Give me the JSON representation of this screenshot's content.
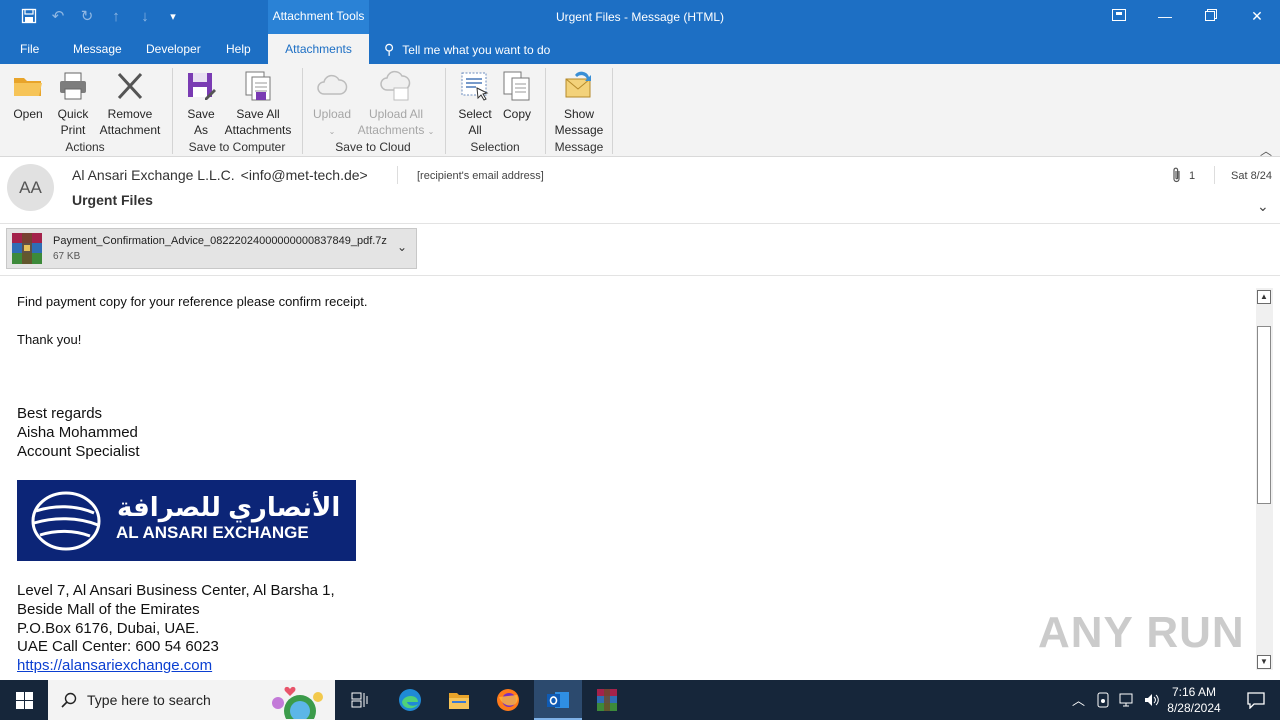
{
  "window": {
    "title": "Urgent Files  -  Message (HTML)",
    "context_tab_group": "Attachment Tools",
    "quick_access": [
      "save-icon",
      "undo-icon",
      "redo-icon",
      "up-arrow-icon",
      "down-arrow-icon",
      "customize-icon"
    ],
    "controls": [
      "ribbon-display-icon",
      "minimize-icon",
      "restore-icon",
      "close-icon"
    ]
  },
  "tabs": {
    "file": "File",
    "message": "Message",
    "developer": "Developer",
    "help": "Help",
    "attachments": "Attachments",
    "tell_me": "Tell me what you want to do"
  },
  "ribbon": {
    "actions": {
      "label": "Actions",
      "open": "Open",
      "quick_print_1": "Quick",
      "quick_print_2": "Print",
      "remove_1": "Remove",
      "remove_2": "Attachment"
    },
    "save_to_computer": {
      "label": "Save to Computer",
      "save_as_1": "Save",
      "save_as_2": "As",
      "save_all_1": "Save All",
      "save_all_2": "Attachments"
    },
    "save_to_cloud": {
      "label": "Save to Cloud",
      "upload": "Upload",
      "upload_all_1": "Upload All",
      "upload_all_2": "Attachments"
    },
    "selection": {
      "label": "Selection",
      "select_all_1": "Select",
      "select_all_2": "All",
      "copy": "Copy"
    },
    "message": {
      "label": "Message",
      "show_1": "Show",
      "show_2": "Message"
    }
  },
  "header": {
    "avatar_initials": "AA",
    "sender_name": "Al Ansari Exchange L.L.C.",
    "sender_email": "<info@met-tech.de>",
    "recipient": "[recipient's email address]",
    "attachment_count": "1",
    "date": "Sat 8/24",
    "subject": "Urgent Files"
  },
  "attachment": {
    "name": "Payment_Confirmation_Advice_08222024000000000837849_pdf.7z",
    "size": "67 KB"
  },
  "body": {
    "line1": "Find payment copy for your reference please confirm receipt.",
    "line2": "Thank you!",
    "regards": "Best regards",
    "name": "Aisha Mohammed",
    "title": "Account Specialist",
    "logo_arabic": "الأنصاري للصرافة",
    "logo_english": "AL ANSARI EXCHANGE",
    "address1": "Level 7, Al Ansari Business Center, Al Barsha 1,",
    "address2": "Beside Mall of the Emirates",
    "address3": "P.O.Box 6176, Dubai, UAE.",
    "call_center": "UAE Call Center: 600 54 6023",
    "website": "https://alansariexchange.com"
  },
  "watermark": "ANY RUN",
  "taskbar": {
    "search_placeholder": "Type here to search",
    "time": "7:16 AM",
    "date": "8/28/2024",
    "apps": [
      "task-view-icon",
      "edge-icon",
      "file-explorer-icon",
      "firefox-icon",
      "outlook-icon",
      "winrar-icon"
    ]
  },
  "colors": {
    "accent": "#1d6fc4",
    "ribbon_bg": "#f3f3f3",
    "taskbar_bg": "#16263a",
    "logo_bg": "#0c2577",
    "link": "#0b3fd1"
  }
}
